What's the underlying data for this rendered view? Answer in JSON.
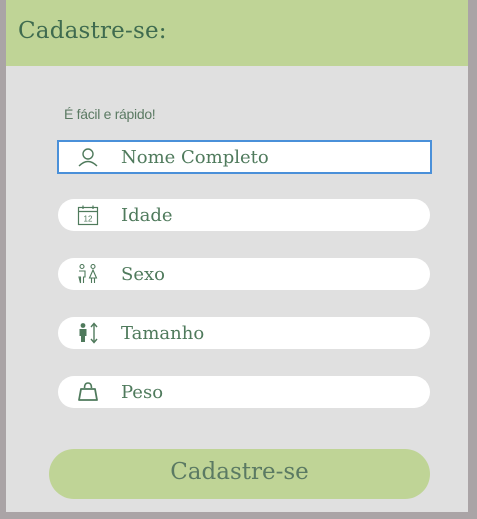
{
  "header": {
    "title": "Cadastre-se:"
  },
  "form": {
    "subtitle": "É fácil e rápido!",
    "fields": [
      {
        "label": "Nome Completo",
        "icon": "user-icon"
      },
      {
        "label": "Idade",
        "icon": "calendar-icon"
      },
      {
        "label": "Sexo",
        "icon": "gender-icon"
      },
      {
        "label": "Tamanho",
        "icon": "height-icon"
      },
      {
        "label": "Peso",
        "icon": "weight-icon"
      }
    ],
    "submit_label": "Cadastre-se",
    "calendar_day": "12"
  },
  "colors": {
    "accent": "#bfd496",
    "text_green": "#4f7a5c",
    "panel": "#e0e0e0",
    "backdrop": "#aaa4a6",
    "focus": "#4a90d9"
  }
}
